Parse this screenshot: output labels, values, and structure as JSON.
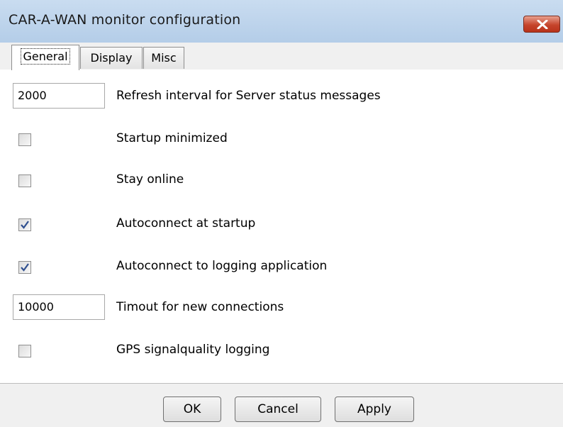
{
  "window": {
    "title": "CAR-A-WAN monitor configuration"
  },
  "tabs": [
    {
      "label": "General",
      "active": true
    },
    {
      "label": "Display",
      "active": false
    },
    {
      "label": "Misc",
      "active": false
    }
  ],
  "general": {
    "refresh_interval": {
      "value": "2000",
      "label": "Refresh interval for Server status messages"
    },
    "startup_minimized": {
      "checked": false,
      "label": "Startup minimized"
    },
    "stay_online": {
      "checked": false,
      "label": "Stay online"
    },
    "autoconnect_startup": {
      "checked": true,
      "label": "Autoconnect at startup"
    },
    "autoconnect_logging": {
      "checked": true,
      "label": "Autoconnect to logging application"
    },
    "connection_timeout": {
      "value": "10000",
      "label": "Timout for new connections"
    },
    "gps_logging": {
      "checked": false,
      "label": "GPS signalquality logging"
    }
  },
  "buttons": {
    "ok": "OK",
    "cancel": "Cancel",
    "apply": "Apply"
  },
  "colors": {
    "titlebar": "#b4cde8",
    "close": "#c6452c",
    "check": "#2f4f8f"
  }
}
